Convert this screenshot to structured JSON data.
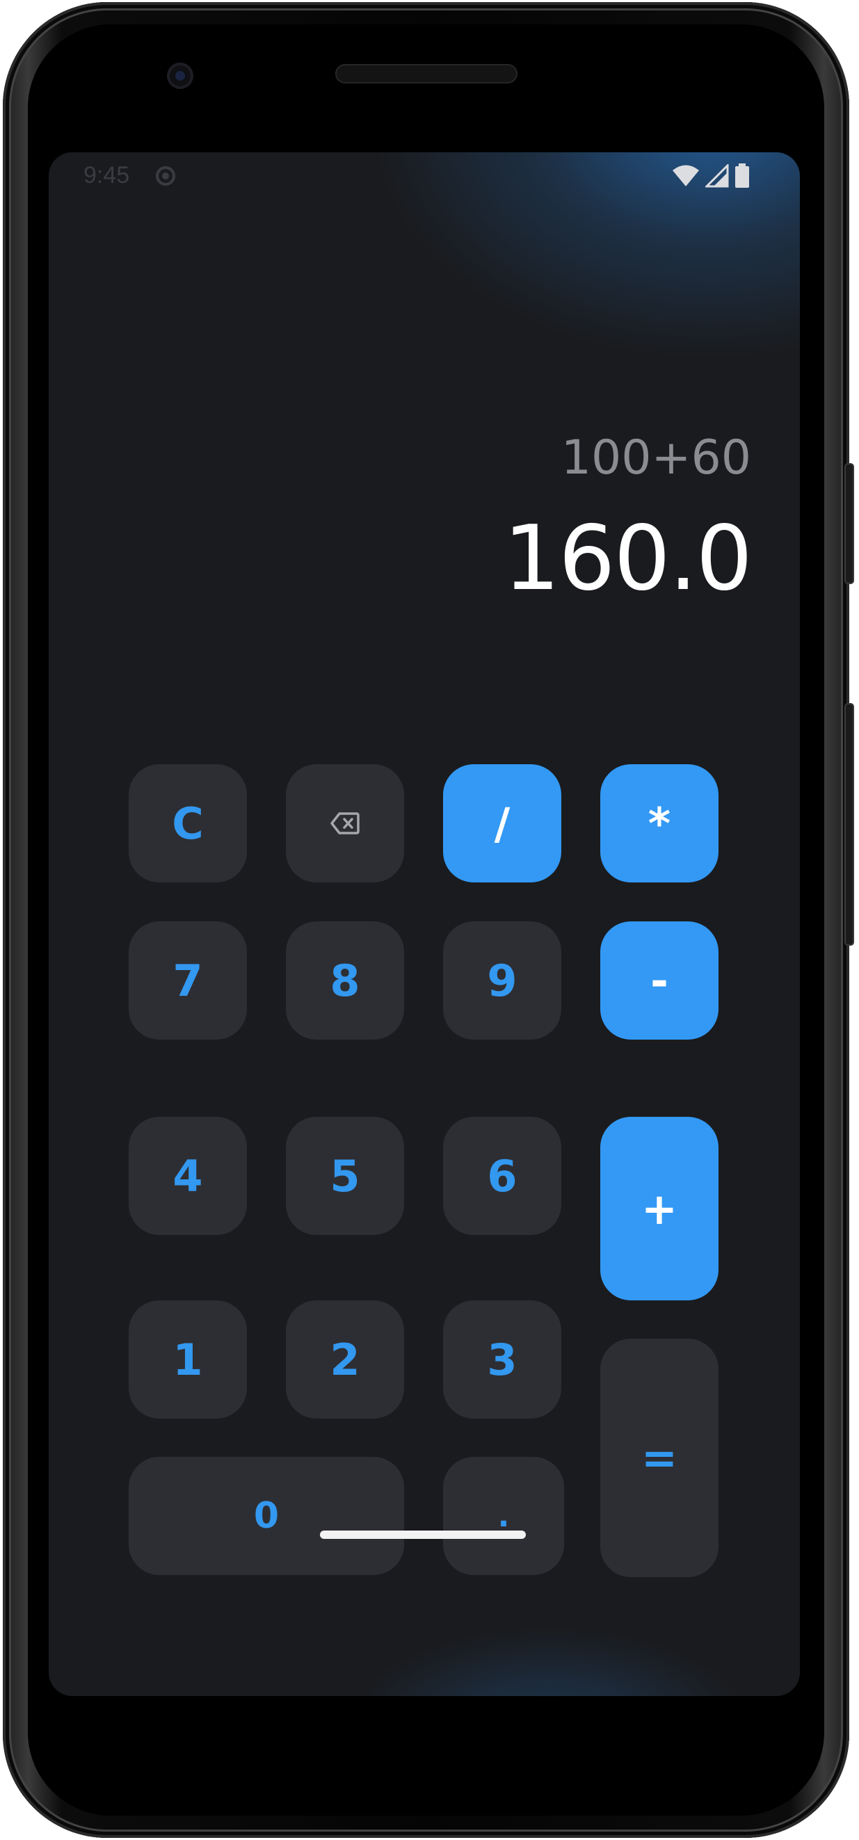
{
  "status_bar": {
    "time": "9:45"
  },
  "display": {
    "expression": "100+60",
    "result": "160.0"
  },
  "keys": {
    "clear": "C",
    "backspace_icon": "backspace-icon",
    "divide": "/",
    "multiply": "*",
    "seven": "7",
    "eight": "8",
    "nine": "9",
    "minus": "-",
    "four": "4",
    "five": "5",
    "six": "6",
    "plus": "+",
    "one": "1",
    "two": "2",
    "three": "3",
    "equals": "=",
    "zero": "0",
    "decimal": "."
  },
  "colors": {
    "screen_background": "#1a1b1e",
    "key_dark": "#2d2e33",
    "key_accent": "#3399f5",
    "key_text_blue": "#3398f0",
    "result_text": "#ffffff",
    "expression_text": "#8a8c92"
  }
}
